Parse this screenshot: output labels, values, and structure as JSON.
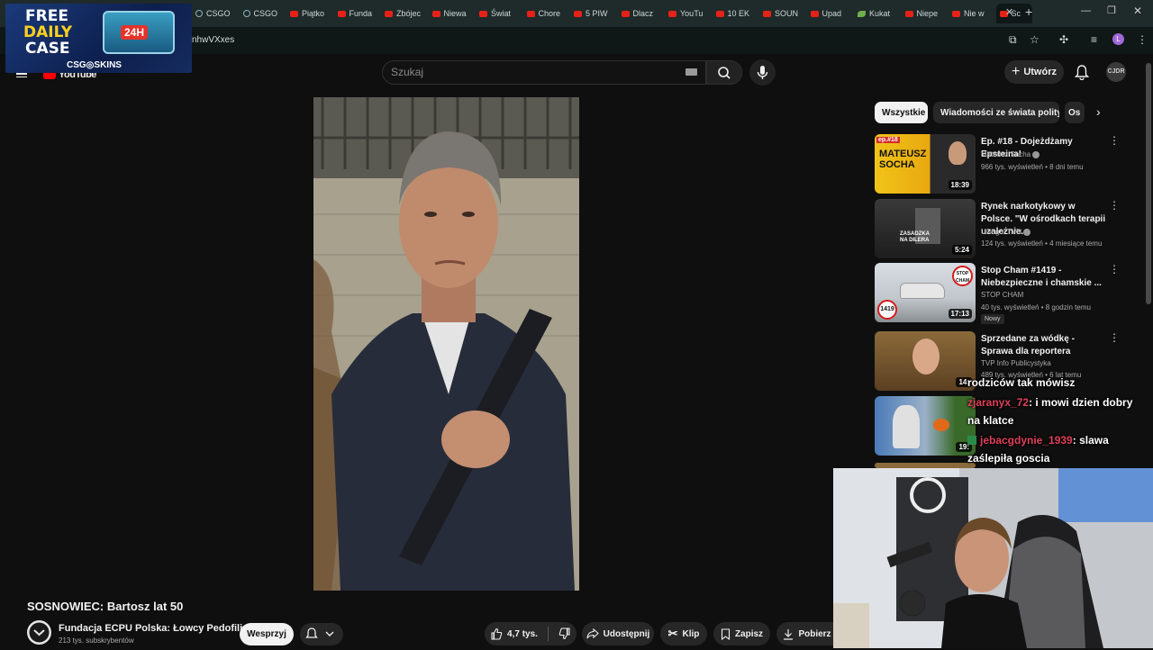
{
  "browser": {
    "tabs": [
      {
        "label": "CSGO",
        "icon": "globe"
      },
      {
        "label": "CSGO",
        "icon": "globe"
      },
      {
        "label": "Piątko",
        "icon": "youtube"
      },
      {
        "label": "Funda",
        "icon": "youtube"
      },
      {
        "label": "Zbójec",
        "icon": "youtube"
      },
      {
        "label": "Niewa",
        "icon": "youtube"
      },
      {
        "label": "Świat",
        "icon": "youtube"
      },
      {
        "label": "Chore",
        "icon": "youtube"
      },
      {
        "label": "5 PIW",
        "icon": "youtube"
      },
      {
        "label": "Dlacz",
        "icon": "youtube"
      },
      {
        "label": "YouTu",
        "icon": "youtube"
      },
      {
        "label": "10 EK",
        "icon": "youtube"
      },
      {
        "label": "SOUN",
        "icon": "youtube"
      },
      {
        "label": "Upad",
        "icon": "youtube"
      },
      {
        "label": "Kukat",
        "icon": "leaf"
      },
      {
        "label": "Niepe",
        "icon": "youtube"
      },
      {
        "label": "Nie w",
        "icon": "youtube"
      },
      {
        "label": "Sc",
        "icon": "youtube",
        "active": true
      }
    ],
    "url_fragment": "nhwVXxes",
    "profile_initial": "L"
  },
  "ad": {
    "line1": "FREE",
    "line2": "DAILY",
    "line3": "CASE",
    "badge": "24H",
    "brand": "CSG◎SKINS"
  },
  "youtube": {
    "logo": "YouTube",
    "search_placeholder": "Szukaj",
    "create_label": "Utwórz",
    "avatar_text": "CJDR"
  },
  "video": {
    "title": "SOSNOWIEC: Bartosz lat 50",
    "channel_name": "Fundacja ECPU Polska: Łowcy Pedofili",
    "subscribers": "213 tys. subskrybentów",
    "support_label": "Wesprzyj",
    "likes": "4,7 tys.",
    "share_label": "Udostępnij",
    "clip_label": "Klip",
    "save_label": "Zapisz",
    "download_label": "Pobierz"
  },
  "chips": [
    "Wszystkie",
    "Wiadomości ze świata polityki",
    "Os"
  ],
  "recommendations": [
    {
      "title": "Ep. #18 - Dojeżdżamy Epsteina!",
      "channel": "Mateusz Socha",
      "verified": true,
      "meta": "966 tys. wyświetleń • 8 dni temu",
      "duration": "18:39",
      "thumb_text": "MATEUSZ SOCHA",
      "thumb_badge": "ep.#18",
      "new": ""
    },
    {
      "title": "Rynek narkotykowy w Polsce. \"W ośrodkach terapii uzależnie...",
      "channel": "Uwaga! TVN",
      "verified": true,
      "meta": "124 tys. wyświetleń • 4 miesiące temu",
      "duration": "5:24",
      "thumb_text": "ZASADZKA NA DILERA",
      "thumb_badge": "",
      "new": ""
    },
    {
      "title": "Stop Cham #1419 - Niebezpieczne i chamskie ...",
      "channel": "STOP CHAM",
      "verified": false,
      "meta": "40 tys. wyświetleń • 8 godzin temu",
      "duration": "17:13",
      "thumb_text": "1419",
      "thumb_badge": "STOP CHAM",
      "new": "Nowy"
    },
    {
      "title": "Sprzedane za wódkę - Sprawa dla reportera",
      "channel": "TVP Info Publicystyka",
      "verified": false,
      "meta": "489 tys. wyświetleń • 6 lat temu",
      "duration": "14:",
      "thumb_text": "",
      "thumb_badge": "",
      "new": ""
    },
    {
      "title": "",
      "channel": "",
      "verified": false,
      "meta": "",
      "duration": "19:",
      "thumb_text": "",
      "thumb_badge": "",
      "new": ""
    }
  ],
  "chat": [
    {
      "user": "",
      "text": "rodziców tak mówisz"
    },
    {
      "user": "zjaranyx_72",
      "text": ": i mowi dzien dobry"
    },
    {
      "user": "",
      "text": "na klatce"
    },
    {
      "user": "jebacgdynie_1939",
      "text": ": slawa"
    },
    {
      "user": "",
      "text": "zaślepiła goscia"
    }
  ],
  "colors": {
    "background": "#0f0f0f",
    "chip_active": "#f1f1f1",
    "button_bg": "#272727",
    "youtube_red": "#ff0000",
    "chat_user": "#e0405a"
  }
}
